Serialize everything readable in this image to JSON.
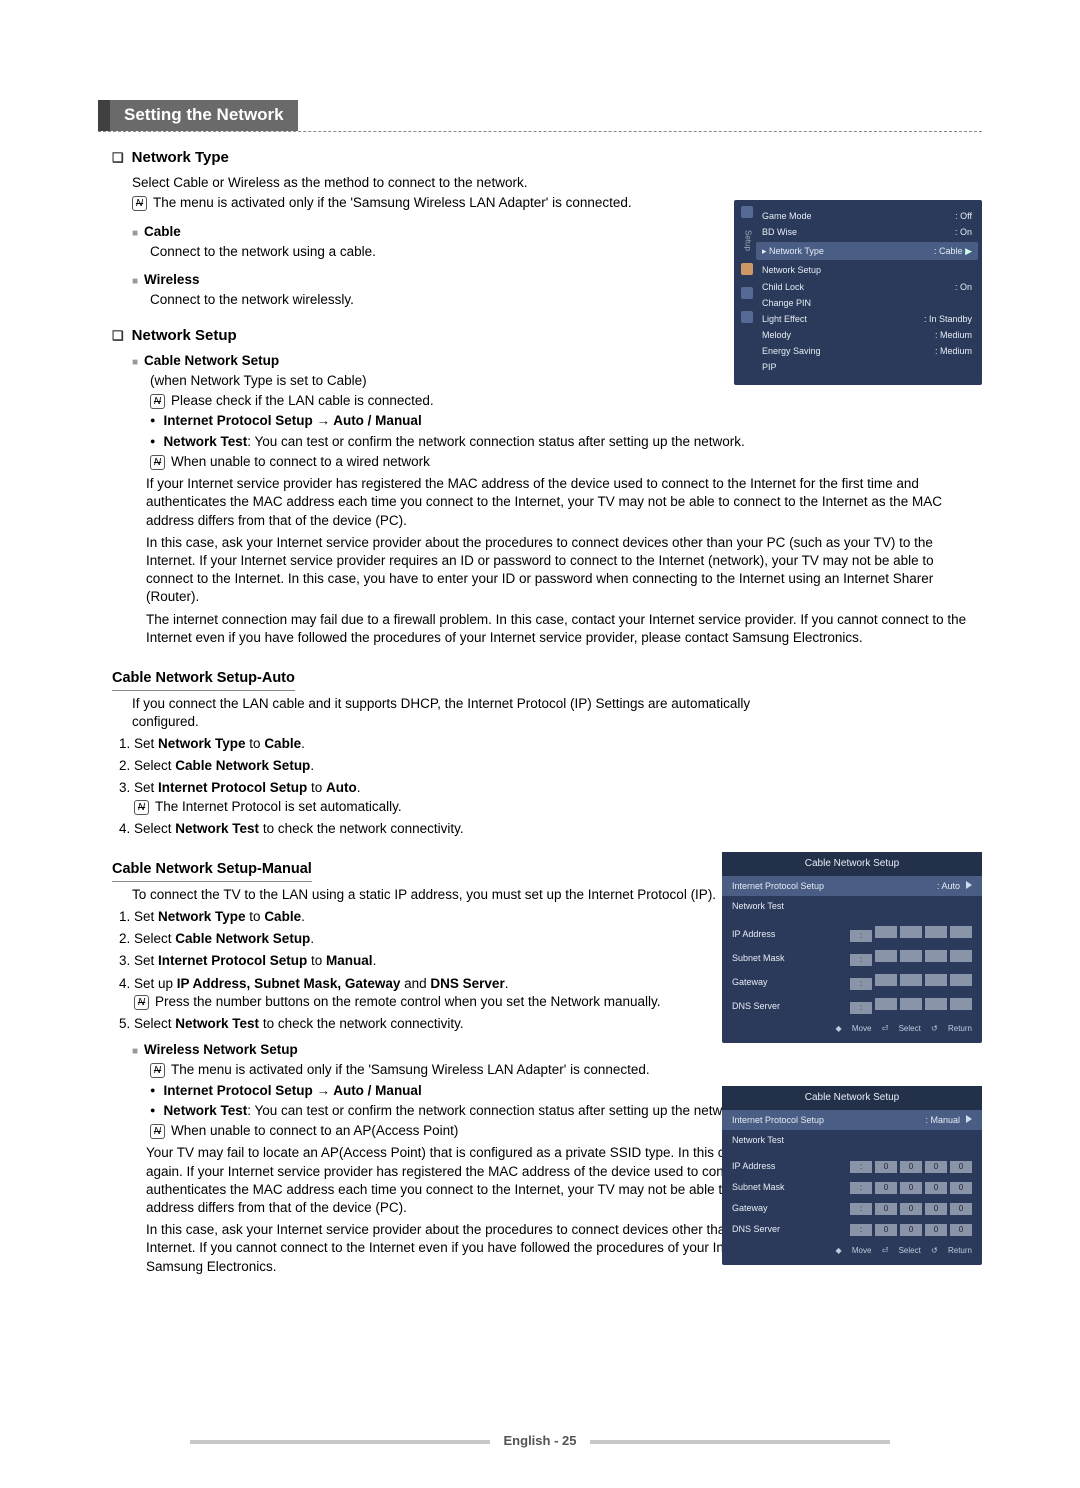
{
  "header": "Setting the Network",
  "network_type": {
    "title": "Network Type",
    "desc": "Select Cable or Wireless as the method to connect to the network.",
    "note": "The menu is activated only if the 'Samsung Wireless LAN Adapter' is connected.",
    "cable": {
      "label": "Cable",
      "desc": "Connect to the network using a cable."
    },
    "wireless": {
      "label": "Wireless",
      "desc": "Connect to the network wirelessly."
    }
  },
  "network_setup": {
    "title": "Network Setup",
    "cable_setup_label": "Cable Network Setup",
    "when": "(when Network Type is set to Cable)",
    "note1": "Please check if the LAN cable is connected.",
    "ip_setup": "Internet Protocol Setup → Auto / Manual",
    "net_test_label": "Network Test",
    "net_test_desc": ": You can test or confirm the network connection status after setting up the network.",
    "note2": "When unable to connect to a wired network",
    "p1": "If your Internet service provider has registered the MAC address of the device used to connect to the Internet for the first time and authenticates the MAC address each time you connect to the Internet, your TV may not be able to connect to the Internet as the MAC address differs from that of the device (PC).",
    "p2": "In this case, ask your Internet service provider about the procedures to connect devices other than your PC (such as your TV) to the Internet. If your Internet service provider requires an ID or password to connect to the Internet (network), your TV may not be able to connect to the Internet. In this case, you have to enter your ID or password when connecting to the Internet using an Internet Sharer (Router).",
    "p3": "The internet connection may fail due to a firewall problem. In this case, contact your Internet service provider. If you cannot connect to the Internet even if you have followed the procedures of your Internet service provider, please contact Samsung Electronics."
  },
  "auto": {
    "title": "Cable Network Setup-Auto",
    "intro": "If you connect the LAN cable and it supports DHCP, the Internet Protocol (IP) Settings are automatically configured.",
    "s1a": "Set ",
    "s1b": "Network Type",
    "s1c": " to ",
    "s1d": "Cable",
    "s1e": ".",
    "s2a": "Select ",
    "s2b": "Cable Network Setup",
    "s2c": ".",
    "s3a": "Set ",
    "s3b": "Internet Protocol Setup",
    "s3c": " to ",
    "s3d": "Auto",
    "s3e": ".",
    "s3note": "The Internet Protocol is set automatically.",
    "s4a": "Select ",
    "s4b": "Network Test",
    "s4c": " to check the network connectivity."
  },
  "manual": {
    "title": "Cable Network Setup-Manual",
    "intro": "To connect the TV to the LAN using a static IP address, you must set up the Internet Protocol (IP).",
    "s1a": "Set ",
    "s1b": "Network Type",
    "s1c": " to ",
    "s1d": "Cable",
    "s1e": ".",
    "s2a": "Select ",
    "s2b": "Cable Network Setup",
    "s2c": ".",
    "s3a": "Set ",
    "s3b": "Internet Protocol Setup",
    "s3c": " to ",
    "s3d": "Manual",
    "s3e": ".",
    "s4a": "Set up ",
    "s4b": "IP Address, Subnet Mask, Gateway",
    "s4c": " and ",
    "s4d": "DNS Server",
    "s4e": ".",
    "s4note": "Press the number buttons on the remote control when you set the Network manually.",
    "s5a": "Select ",
    "s5b": "Network Test",
    "s5c": " to check the network connectivity."
  },
  "wireless_setup": {
    "label": "Wireless Network Setup",
    "note1": "The menu is activated only if the 'Samsung Wireless LAN Adapter' is connected.",
    "ip_setup": "Internet Protocol Setup → Auto / Manual",
    "net_test_label": "Network Test",
    "net_test_desc": ": You can test or confirm the network connection status after setting up the network.",
    "note2": "When unable to connect to an AP(Access Point)",
    "p1": "Your TV may fail to locate an AP(Access Point) that is configured as a private SSID type. In this case, please change the AP settings and try again. If your Internet service provider has registered the MAC address of the device used to connect to the Internet for the first time and authenticates the MAC address each time you connect to the Internet, your TV may not be able to connect to the Internet as the MAC address differs from that of the device (PC).",
    "p2": "In this case, ask your Internet service provider about the procedures to connect devices other than your PC (such as your TV) to the Internet. If you cannot connect to the Internet even if you have followed the procedures of your Internet service provider, please contact a Samsung Electronics."
  },
  "osd1": {
    "game_mode": "Game Mode",
    "game_mode_v": ": Off",
    "bd_wise": "BD Wise",
    "bd_wise_v": ": On",
    "network_type": "Network Type",
    "network_type_v": ": Cable",
    "network_setup": "Network Setup",
    "child_lock": "Child Lock",
    "child_lock_v": ": On",
    "change_pin": "Change PIN",
    "light_effect": "Light Effect",
    "light_effect_v": ": In Standby",
    "melody": "Melody",
    "melody_v": ": Medium",
    "energy_saving": "Energy Saving",
    "energy_saving_v": ": Medium",
    "pip": "PIP",
    "setup_tab": "Setup",
    "arrow": "▶"
  },
  "osd2": {
    "title": "Cable Network Setup",
    "ips": "Internet Protocol Setup",
    "ips_v": ": Auto",
    "nt": "Network Test",
    "ip": "IP Address",
    "sm": "Subnet Mask",
    "gw": "Gateway",
    "dns": "DNS Server",
    "foot_move": "Move",
    "foot_select": "Select",
    "foot_return": "Return",
    "dot": ":"
  },
  "osd3": {
    "title": "Cable Network Setup",
    "ips": "Internet Protocol Setup",
    "ips_v": ": Manual",
    "nt": "Network Test",
    "ip": "IP Address",
    "sm": "Subnet Mask",
    "gw": "Gateway",
    "dns": "DNS Server",
    "v0": "0",
    "foot_move": "Move",
    "foot_select": "Select",
    "foot_return": "Return",
    "dot": ":"
  },
  "footer": "English - 25"
}
